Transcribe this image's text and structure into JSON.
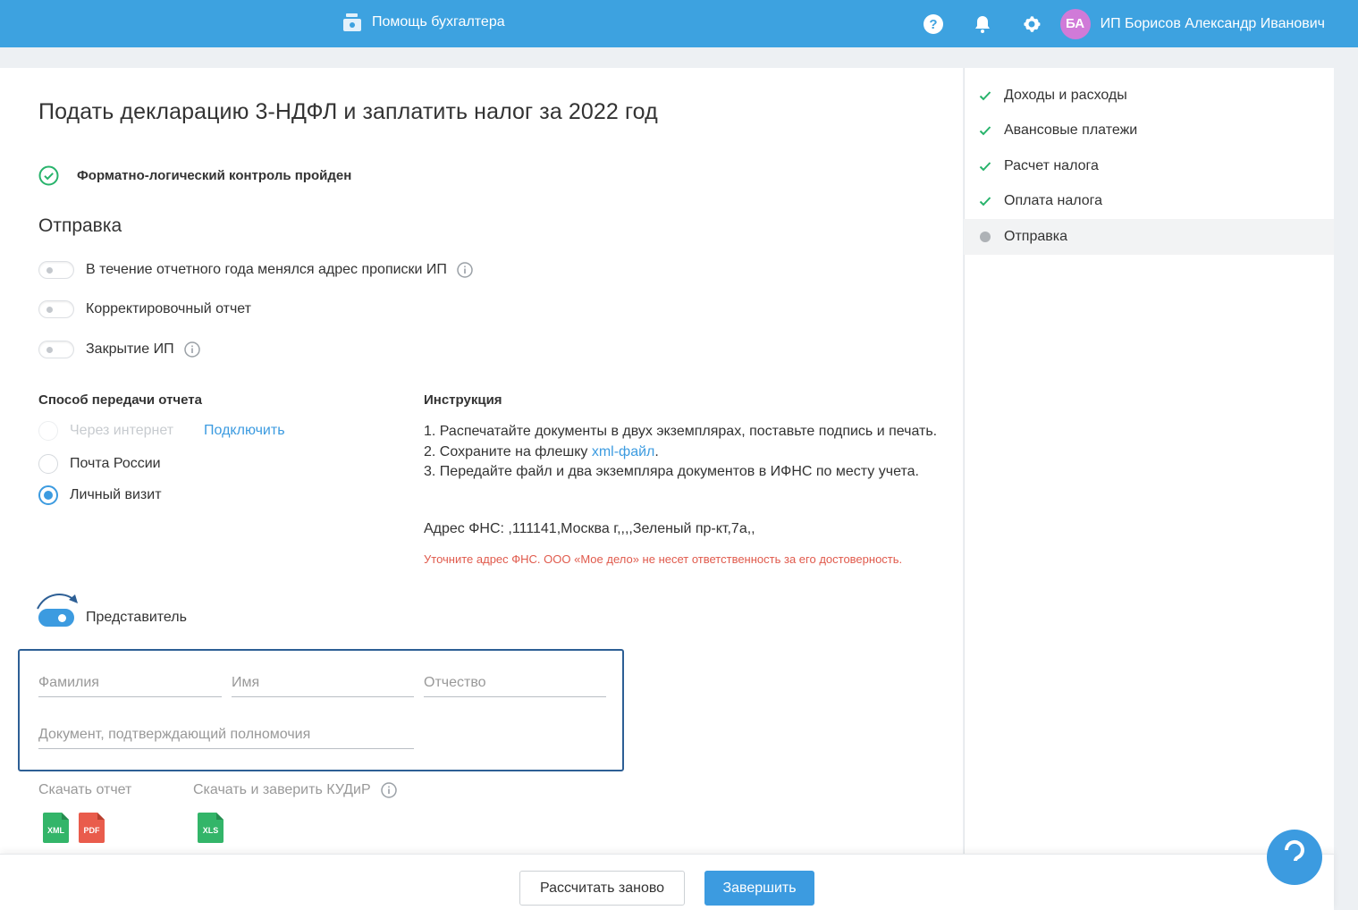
{
  "header": {
    "helper_label": "Помощь бухгалтера",
    "avatar_initials": "БА",
    "username": "ИП Борисов Александр Иванович",
    "bg_color": "#3da2e0"
  },
  "page": {
    "title": "Подать декларацию 3-НДФЛ и заплатить налог за 2022 год",
    "flk_status": "Форматно-логический контроль пройден",
    "send_heading": "Отправка"
  },
  "toggles": {
    "address_changed": "В течение отчетного года менялся адрес прописки ИП",
    "correction": "Корректировочный отчет",
    "closing": "Закрытие ИП",
    "representative": "Представитель"
  },
  "transfer": {
    "label": "Способ передачи отчета",
    "internet": "Через интернет",
    "connect_link": "Подключить",
    "post": "Почта России",
    "visit": "Личный визит"
  },
  "instruction": {
    "label": "Инструкция",
    "step1": "1. Распечатайте документы в двух экземплярах, поставьте подпись и печать.",
    "step2_prefix": "2. Сохраните на флешку ",
    "step2_link": "xml-файл",
    "step2_suffix": ".",
    "step3": "3. Передайте файл и два экземпляра документов в ИФНС по месту учета.",
    "address": "Адрес ФНС: ,111141,Москва г,,,,Зеленый пр-кт,7а,,",
    "warning": "Уточните адрес ФНС. ООО «Мое дело» не несет ответственность за его достоверность."
  },
  "representative_form": {
    "surname_placeholder": "Фамилия",
    "name_placeholder": "Имя",
    "patronymic_placeholder": "Отчество",
    "document_placeholder": "Документ, подтверждающий полномочия"
  },
  "downloads": {
    "report_label": "Скачать отчет",
    "kudir_label": "Скачать и заверить КУДиР",
    "xml": "XML",
    "pdf": "PDF",
    "xls": "XLS"
  },
  "footer": {
    "recalc": "Рассчитать заново",
    "finish": "Завершить"
  },
  "steps": [
    {
      "label": "Доходы и расходы",
      "state": "done"
    },
    {
      "label": "Авансовые платежи",
      "state": "done"
    },
    {
      "label": "Расчет налога",
      "state": "done"
    },
    {
      "label": "Оплата налога",
      "state": "done"
    },
    {
      "label": "Отправка",
      "state": "active"
    }
  ]
}
